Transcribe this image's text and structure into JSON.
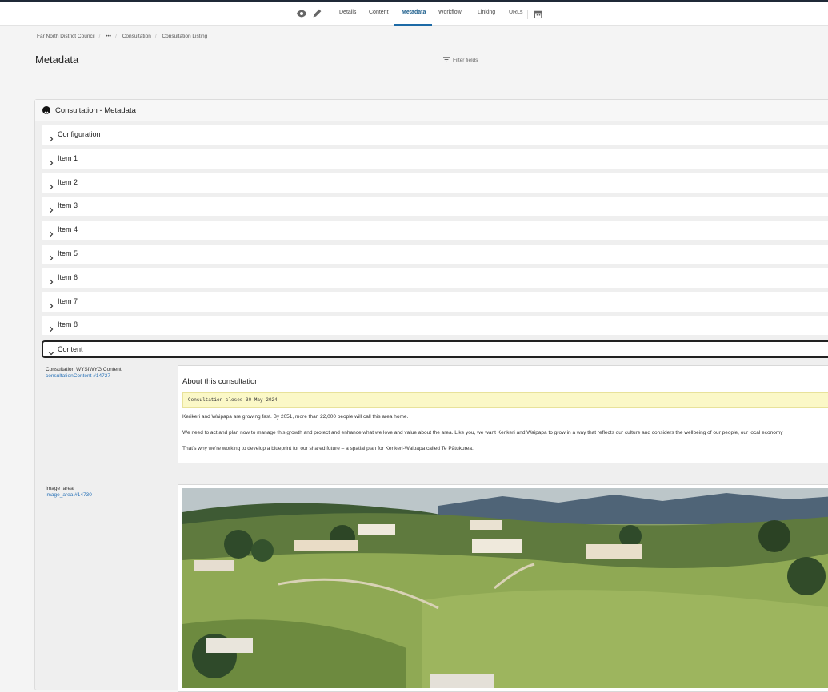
{
  "topbar": {
    "tabs": [
      "Details",
      "Content",
      "Metadata",
      "Workflow",
      "Linking",
      "URLs"
    ],
    "active_tab": "Metadata"
  },
  "breadcrumb": {
    "items": [
      "Far North District Council",
      "•••",
      "Consultation",
      "Consultation Listing"
    ]
  },
  "page": {
    "title": "Metadata",
    "filter_label": "Filter fields"
  },
  "panel": {
    "title": "Consultation - Metadata",
    "sections": [
      "Configuration",
      "Item 1",
      "Item 2",
      "Item 3",
      "Item 4",
      "Item 5",
      "Item 6",
      "Item 7",
      "Item 8"
    ],
    "open_section": "Content"
  },
  "fields": {
    "wysiwyg": {
      "label": "Consultation WYSIWYG Content",
      "id_link": "consultationContent #14727",
      "heading": "About this consultation",
      "code_line": "Consultation closes 30 May 2024",
      "p1": "Kerikeri and Waipapa are growing fast. By 2051, more than 22,000 people will call this area home.",
      "p2": "We need to act and plan now to manage this growth and protect and enhance what we love and value about the area. Like you, we want Kerikeri and Waipapa to grow in a way that reflects our culture and considers the wellbeing of our people, our local economy",
      "p3": "That's why we're working to develop a blueprint for our shared future – a spatial plan for Kerikeri-Waipapa called Te Pātukurea."
    },
    "image": {
      "label": "Image_area",
      "id_link": "image_area #14730"
    }
  }
}
